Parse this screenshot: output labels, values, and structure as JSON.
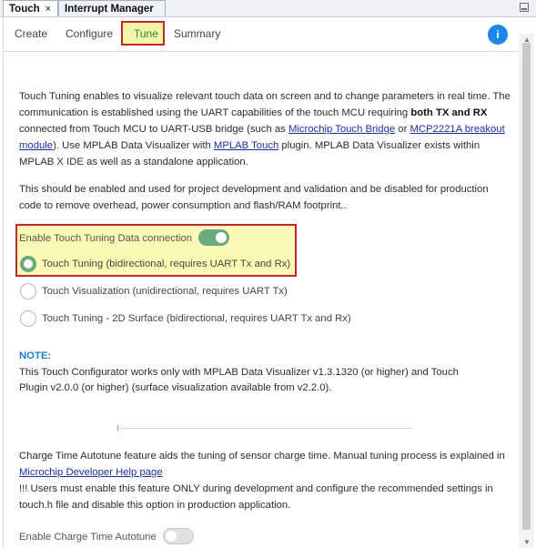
{
  "tabs": [
    {
      "label": "Touch",
      "close": "×"
    },
    {
      "label": "Interrupt Manager"
    }
  ],
  "nav": {
    "create": "Create",
    "configure": "Configure",
    "tune": "Tune",
    "summary": "Summary",
    "info_icon": "i"
  },
  "intro": {
    "t1": "Touch Tuning enables to visualize relevant touch data on screen and to change parameters in real time. The communication is established using the UART capabilities of the touch MCU requiring ",
    "bold": "both TX and RX",
    "t2": " connected from Touch MCU to UART-USB bridge (such as ",
    "link1": "Microchip Touch Bridge",
    "t3": " or ",
    "link2": "MCP2221A breakout module",
    "t4": "). Use MPLAB Data Visualizer with ",
    "link3": "MPLAB Touch",
    "t5": " plugin. MPLAB Data Visualizer exists within MPLAB X IDE as well as a standalone application."
  },
  "dev_note": "This should be enabled and used for project development and validation and be disabled for production code to remove overhead, power consumption and flash/RAM footprint..",
  "tuning": {
    "enable_label": "Enable Touch Tuning Data connection",
    "enabled": true,
    "options": [
      "Touch Tuning (bidirectional, requires UART Tx and Rx)",
      "Touch Visualization (unidirectional, requires UART Tx)",
      "Touch Tuning - 2D Surface (bidirectional, requires UART Tx and Rx)"
    ],
    "selected_index": 0
  },
  "note": {
    "heading": "NOTE:",
    "text": "This Touch Configurator works only with MPLAB Data Visualizer v1.3.1320 (or higher) and Touch Plugin v2.0.0 (or higher) (surface visualization available from v2.2.0)."
  },
  "autotune": {
    "t1": "Charge Time Autotune feature aids the tuning of sensor charge time. Manual tuning process is explained in ",
    "link": "Microchip Developer Help page",
    "t2": "!!! Users must enable this feature ONLY during development and configure the recommended settings in touch.h file and disable this option in production application.",
    "enable_label": "Enable Charge Time Autotune",
    "enabled": false
  },
  "colors": {
    "accent_green": "#6aaa7e",
    "highlight_red": "#c0262b",
    "highlight_yellow": "#fafab4",
    "info_blue": "#1c87e8"
  }
}
